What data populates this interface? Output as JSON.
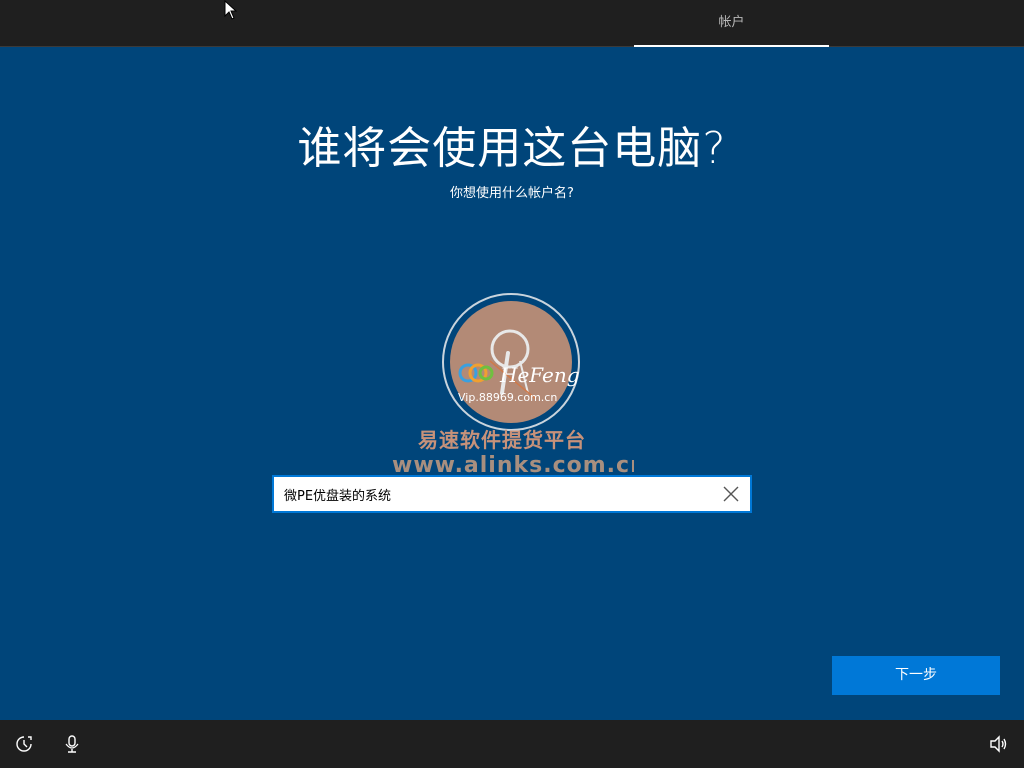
{
  "top_tabs": [
    {
      "label": "帐户",
      "active": true
    }
  ],
  "header": {
    "title": "谁将会使用这台电脑?",
    "subtitle": "你想使用什么帐户名?"
  },
  "watermark": {
    "brand": "HeFeng",
    "url": "Vip.88969.com.cn",
    "platform_cn": "易速软件提货平台",
    "site": "www.alinks.com.cn"
  },
  "name_input": {
    "value": "微PE优盘装的系统",
    "clear_icon": "close-icon"
  },
  "next_button": {
    "label": "下一步"
  },
  "bottom_icons": {
    "left": [
      "ease-of-access-icon",
      "microphone-icon"
    ],
    "right": [
      "volume-icon"
    ]
  },
  "colors": {
    "background": "#00457a",
    "accent": "#0078d7",
    "bar": "#1f1f1f"
  }
}
